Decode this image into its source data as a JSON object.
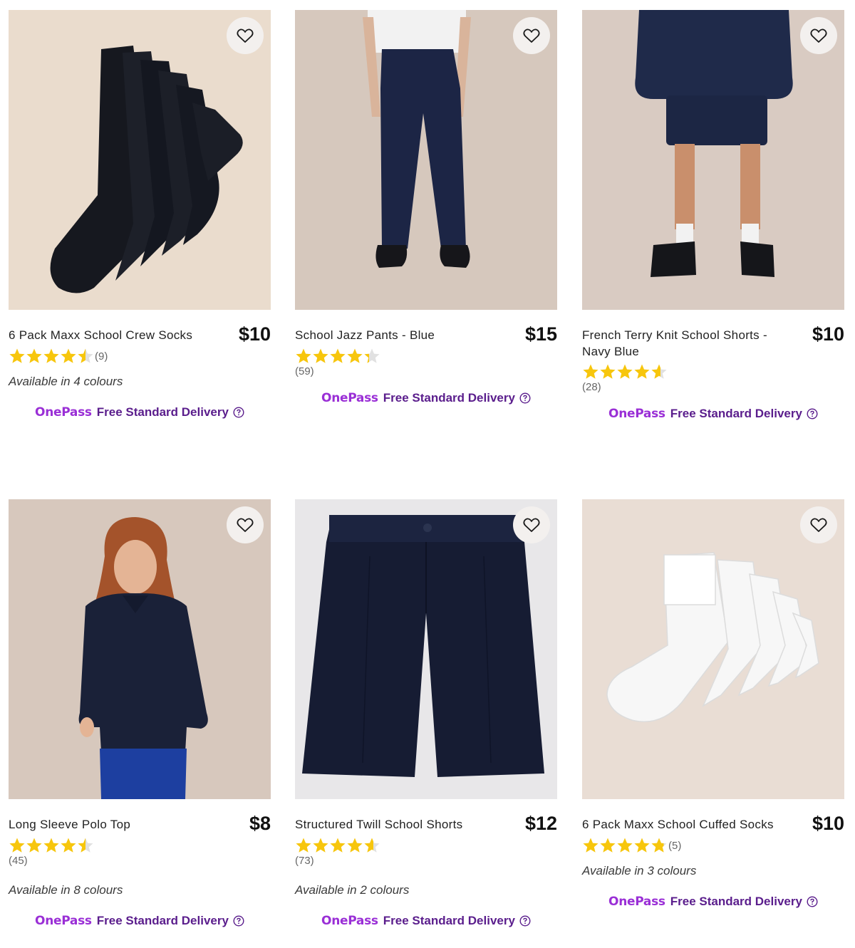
{
  "products": [
    {
      "title": "6 Pack Maxx School Crew Socks",
      "price": "$10",
      "rating": 4.5,
      "count": "(9)",
      "colours": "Available in 4 colours",
      "image": "navy crew socks",
      "bg": "#eadccd"
    },
    {
      "title": "School Jazz Pants - Blue",
      "price": "$15",
      "rating": 4.3,
      "count": "(59)",
      "colours": "",
      "image": "navy jazz pants",
      "bg": "#d6c8bd"
    },
    {
      "title": "French Terry Knit School Shorts - Navy Blue",
      "price": "$10",
      "rating": 4.6,
      "count": "(28)",
      "colours": "",
      "image": "navy terry shorts",
      "bg": "#d9cbc2"
    },
    {
      "title": "Long Sleeve Polo Top",
      "price": "$8",
      "rating": 4.5,
      "count": "(45)",
      "colours": "Available in 8 colours",
      "image": "navy polo top",
      "bg": "#d7c8bd"
    },
    {
      "title": "Structured Twill School Shorts",
      "price": "$12",
      "rating": 4.6,
      "count": "(73)",
      "colours": "Available in 2 colours",
      "image": "navy twill shorts",
      "bg": "#e8e7e9"
    },
    {
      "title": "6 Pack Maxx School Cuffed Socks",
      "price": "$10",
      "rating": 4.8,
      "count": "(5)",
      "colours": "Available in 3 colours",
      "image": "white cuffed socks",
      "bg": "#e9ddd4"
    }
  ],
  "delivery": {
    "brand": "OnePass",
    "text": "Free Standard Delivery"
  },
  "colors": {
    "brand": "#9a2fd6",
    "delivery": "#5a1d8c",
    "star": "#f7c60d",
    "star_empty": "#e1e1e1"
  }
}
